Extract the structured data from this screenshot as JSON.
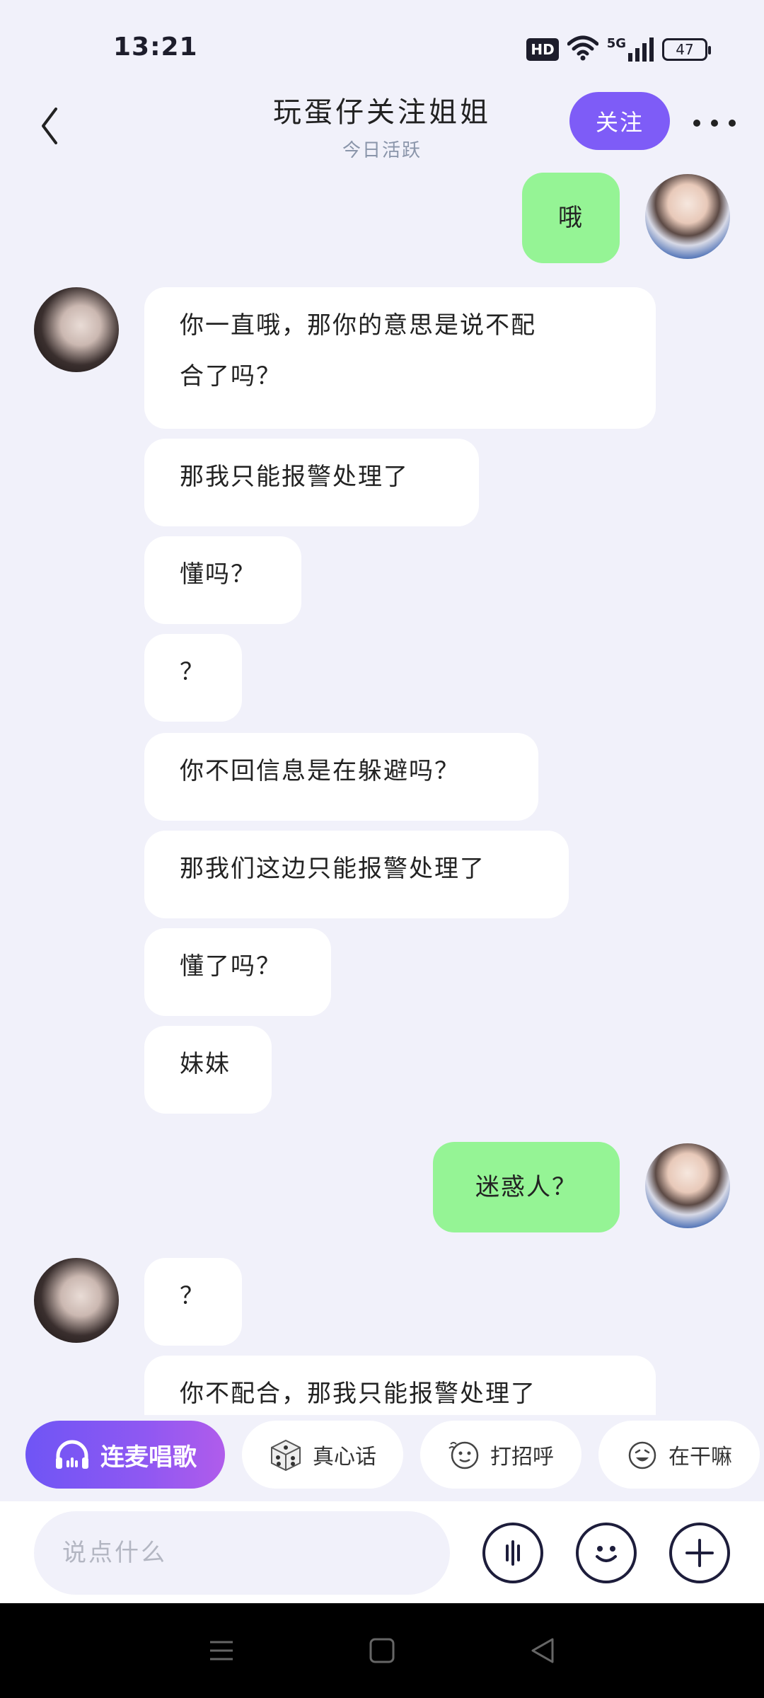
{
  "status_bar": {
    "time": "13:21",
    "hd": "HD",
    "signal_label": "5G",
    "battery": "47",
    "icons": [
      "hd-icon",
      "wifi-icon",
      "signal-5g-icon",
      "battery-icon"
    ]
  },
  "header": {
    "title": "玩蛋仔关注姐姐",
    "subtitle": "今日活跃",
    "follow_label": "关注",
    "back_icon": "chevron-left-icon",
    "more_icon": "more-dots-icon",
    "accent_color": "#7e5cf7"
  },
  "messages": [
    {
      "sender": "me",
      "text": "哦"
    },
    {
      "sender": "her",
      "text": "你一直哦，那你的意思是说不配"
    },
    {
      "sender": "her",
      "text": "合了吗？"
    },
    {
      "sender": "her",
      "text": "那我只能报警处理了"
    },
    {
      "sender": "her",
      "text": "懂吗？"
    },
    {
      "sender": "her",
      "text": "？"
    },
    {
      "sender": "her",
      "text": "你不回信息是在躲避吗？"
    },
    {
      "sender": "her",
      "text": "那我们这边只能报警处理了"
    },
    {
      "sender": "her",
      "text": "懂了吗？"
    },
    {
      "sender": "her",
      "text": "妹妹"
    },
    {
      "sender": "me",
      "text": "迷惑人？"
    },
    {
      "sender": "her",
      "text": "？"
    },
    {
      "sender": "her",
      "text": "你不配合，那我只能报警处理了"
    }
  ],
  "bubble_colors": {
    "me": "#95f495",
    "her": "#ffffff"
  },
  "quick_actions": {
    "karaoke": "连麦唱歌",
    "truth": "真心话",
    "greet": "打招呼",
    "doing": "在干嘛"
  },
  "input": {
    "placeholder": "说点什么",
    "voice_icon": "voice-icon",
    "emoji_icon": "emoji-icon",
    "plus_icon": "plus-icon"
  },
  "nav": {
    "icons": [
      "menu-icon",
      "home-square-icon",
      "back-triangle-icon"
    ]
  }
}
